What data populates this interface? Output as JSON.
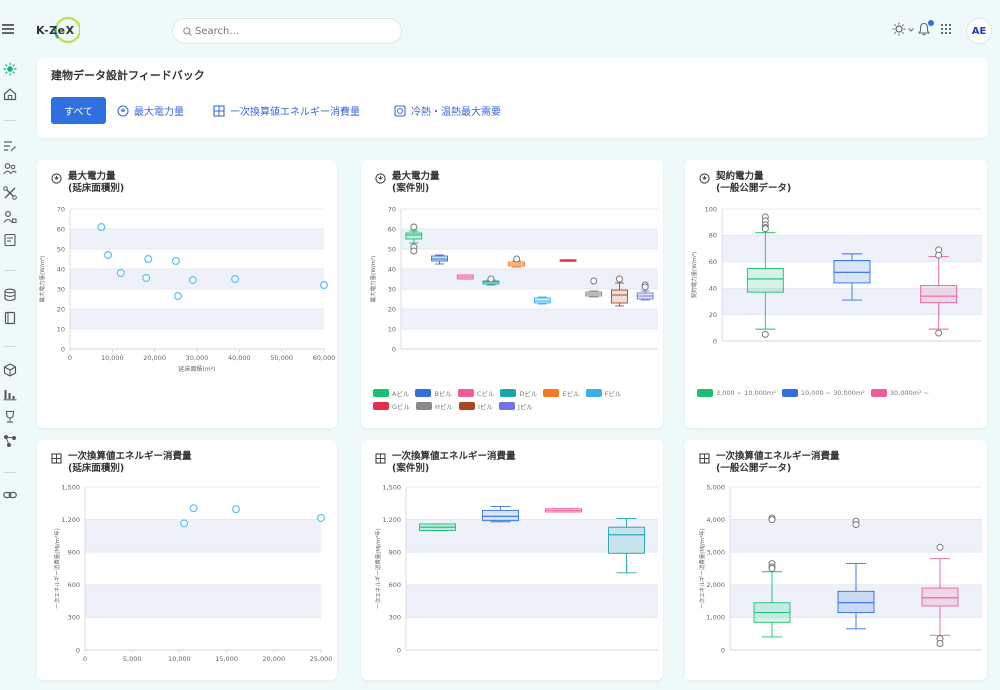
{
  "app": {
    "logo_text": "K-ZeX"
  },
  "search": {
    "placeholder": "Search..."
  },
  "user": {
    "initials": "AE"
  },
  "page": {
    "title": "建物データ設計フィードバック"
  },
  "tabs": {
    "all": "すべて",
    "max_power": "最大電力量",
    "primary_energy": "一次換算値エネルギー消費量",
    "cooling_heating": "冷熱・温熱最大需要"
  },
  "colors": {
    "accent": "#2f6fe0",
    "scatter": "#59c3ea"
  },
  "charts": {
    "c1": {
      "icon": "power-icon",
      "title1": "最大電力量",
      "title2": "(延床面積別)"
    },
    "c2": {
      "icon": "power-icon",
      "title1": "最大電力量",
      "title2": "(案件別)"
    },
    "c3": {
      "icon": "power-icon",
      "title1": "契約電力量",
      "title2": "(一般公開データ)"
    },
    "c4": {
      "icon": "energy-icon",
      "title1": "一次換算値エネルギー消費量",
      "title2": "(延床面積別)"
    },
    "c5": {
      "icon": "energy-icon",
      "title1": "一次換算値エネルギー消費量",
      "title2": "(案件別)"
    },
    "c6": {
      "icon": "energy-icon",
      "title1": "一次換算値エネルギー消費量",
      "title2": "(一般公開データ)"
    }
  },
  "chart_data": [
    {
      "id": "c1",
      "type": "scatter",
      "xlabel": "延床面積(m²)",
      "ylabel": "最大電力量(W/m²)",
      "xlim": [
        0,
        60000
      ],
      "ylim": [
        0,
        70
      ],
      "xticks": [
        "0",
        "10,000",
        "20,000",
        "30,000",
        "40,000",
        "50,000",
        "60,000"
      ],
      "yticks": [
        "0",
        "10",
        "20",
        "30",
        "40",
        "50",
        "60",
        "70"
      ],
      "points": [
        [
          7400,
          61
        ],
        [
          9000,
          47
        ],
        [
          12000,
          38
        ],
        [
          18000,
          35.5
        ],
        [
          18500,
          45
        ],
        [
          25000,
          44
        ],
        [
          25500,
          26.5
        ],
        [
          29000,
          34.5
        ],
        [
          39000,
          35
        ],
        [
          60000,
          32
        ]
      ]
    },
    {
      "id": "c2",
      "type": "box",
      "ylabel": "最大電力量(W/m²)",
      "ylim": [
        0,
        70
      ],
      "yticks": [
        "0",
        "10",
        "20",
        "30",
        "40",
        "50",
        "60",
        "70"
      ],
      "series": [
        {
          "name": "Aビル",
          "color": "#16c172",
          "q1": 55,
          "med": 57,
          "q3": 58,
          "min": 53,
          "max": 59,
          "outliers": [
            61,
            51,
            49
          ]
        },
        {
          "name": "Bビル",
          "color": "#2f6fe0",
          "q1": 44,
          "med": 45,
          "q3": 46.5,
          "min": 42.5,
          "max": 47,
          "outliers": []
        },
        {
          "name": "Cビル",
          "color": "#ee5c9c",
          "q1": 35,
          "med": 36,
          "q3": 37,
          "min": 35,
          "max": 37,
          "outliers": []
        },
        {
          "name": "Dビル",
          "color": "#1aa6a6",
          "q1": 32.5,
          "med": 33.5,
          "q3": 34,
          "min": 32,
          "max": 34.5,
          "outliers": [
            35
          ]
        },
        {
          "name": "Eビル",
          "color": "#f47a22",
          "q1": 41.5,
          "med": 42.5,
          "q3": 43.5,
          "min": 41,
          "max": 44,
          "outliers": [
            45
          ]
        },
        {
          "name": "Fビル",
          "color": "#3ab0ee",
          "q1": 23,
          "med": 24,
          "q3": 25.5,
          "min": 22.5,
          "max": 26,
          "outliers": []
        },
        {
          "name": "Gビル",
          "color": "#e0304a",
          "q1": 44,
          "med": 44.3,
          "q3": 44.6,
          "min": 44,
          "max": 44.6,
          "outliers": []
        },
        {
          "name": "Hビル",
          "color": "#888888",
          "q1": 26.5,
          "med": 27.5,
          "q3": 28.5,
          "min": 26,
          "max": 29,
          "outliers": [
            34
          ]
        },
        {
          "name": "Iビル",
          "color": "#a84a20",
          "q1": 23,
          "med": 27,
          "q3": 29.5,
          "min": 21.5,
          "max": 33,
          "outliers": [
            35
          ]
        },
        {
          "name": "Jビル",
          "color": "#7075e6",
          "q1": 25,
          "med": 26.5,
          "q3": 28,
          "min": 24.5,
          "max": 29,
          "outliers": [
            32,
            31
          ]
        }
      ]
    },
    {
      "id": "c3",
      "type": "box",
      "ylabel": "契約電力量(W/m²)",
      "ylim": [
        0,
        100
      ],
      "yticks": [
        "0",
        "20",
        "40",
        "60",
        "80",
        "100"
      ],
      "series": [
        {
          "name": "3,000 ~ 10,000m²",
          "color": "#16c172",
          "q1": 37,
          "med": 47,
          "q3": 55,
          "min": 9,
          "max": 82,
          "outliers": [
            94,
            91,
            88,
            86,
            85,
            5
          ]
        },
        {
          "name": "10,000 ~ 30,000m²",
          "color": "#2f6fe0",
          "q1": 44,
          "med": 52,
          "q3": 61,
          "min": 31,
          "max": 66,
          "outliers": []
        },
        {
          "name": "30,000m² ~",
          "color": "#ee5c9c",
          "q1": 29,
          "med": 34,
          "q3": 42,
          "min": 9,
          "max": 64,
          "outliers": [
            69,
            65,
            6
          ]
        }
      ]
    },
    {
      "id": "c4",
      "type": "scatter",
      "ylabel": "一次エネルギー消費量(MJ/m²年)",
      "xlim": [
        0,
        25000
      ],
      "ylim": [
        0,
        1500
      ],
      "xticks": [
        "0",
        "5,000",
        "10,000",
        "15,000",
        "20,000",
        "25,000"
      ],
      "yticks": [
        "0",
        "300",
        "600",
        "900",
        "1,200",
        "1,500"
      ],
      "points": [
        [
          10500,
          1165
        ],
        [
          11500,
          1305
        ],
        [
          16000,
          1295
        ],
        [
          25000,
          1215
        ]
      ]
    },
    {
      "id": "c5",
      "type": "box",
      "ylabel": "一次エネルギー消費量(MJ/m²年)",
      "ylim": [
        0,
        1500
      ],
      "yticks": [
        "0",
        "300",
        "600",
        "900",
        "1,200",
        "1,500"
      ],
      "series": [
        {
          "name": "Aビル",
          "color": "#16c172",
          "q1": 1100,
          "med": 1130,
          "q3": 1160,
          "min": 1100,
          "max": 1160,
          "outliers": []
        },
        {
          "name": "Bビル",
          "color": "#2f6fe0",
          "q1": 1190,
          "med": 1230,
          "q3": 1285,
          "min": 1180,
          "max": 1320,
          "outliers": []
        },
        {
          "name": "Cビル",
          "color": "#ee5c9c",
          "q1": 1270,
          "med": 1285,
          "q3": 1300,
          "min": 1270,
          "max": 1300,
          "outliers": []
        },
        {
          "name": "Dビル",
          "color": "#1aa6a6",
          "q1": 890,
          "med": 1060,
          "q3": 1130,
          "min": 710,
          "max": 1210,
          "outliers": []
        }
      ]
    },
    {
      "id": "c6",
      "type": "box",
      "ylabel": "一次エネルギー消費量(MJ/m²年)",
      "ylim": [
        0,
        5000
      ],
      "yticks": [
        "0",
        "1,000",
        "2,000",
        "3,000",
        "4,000",
        "5,000"
      ],
      "series": [
        {
          "name": "3,000 ~ 10,000m²",
          "color": "#16c172",
          "q1": 850,
          "med": 1150,
          "q3": 1450,
          "min": 400,
          "max": 2400,
          "outliers": [
            4050,
            4000,
            2650,
            2550,
            2500
          ]
        },
        {
          "name": "10,000 ~ 30,000m²",
          "color": "#2f6fe0",
          "q1": 1150,
          "med": 1450,
          "q3": 1800,
          "min": 650,
          "max": 2650,
          "outliers": [
            3950,
            3850
          ]
        },
        {
          "name": "30,000m² ~",
          "color": "#ee5c9c",
          "q1": 1350,
          "med": 1600,
          "q3": 1900,
          "min": 450,
          "max": 2800,
          "outliers": [
            3150,
            350,
            200
          ]
        }
      ]
    }
  ]
}
